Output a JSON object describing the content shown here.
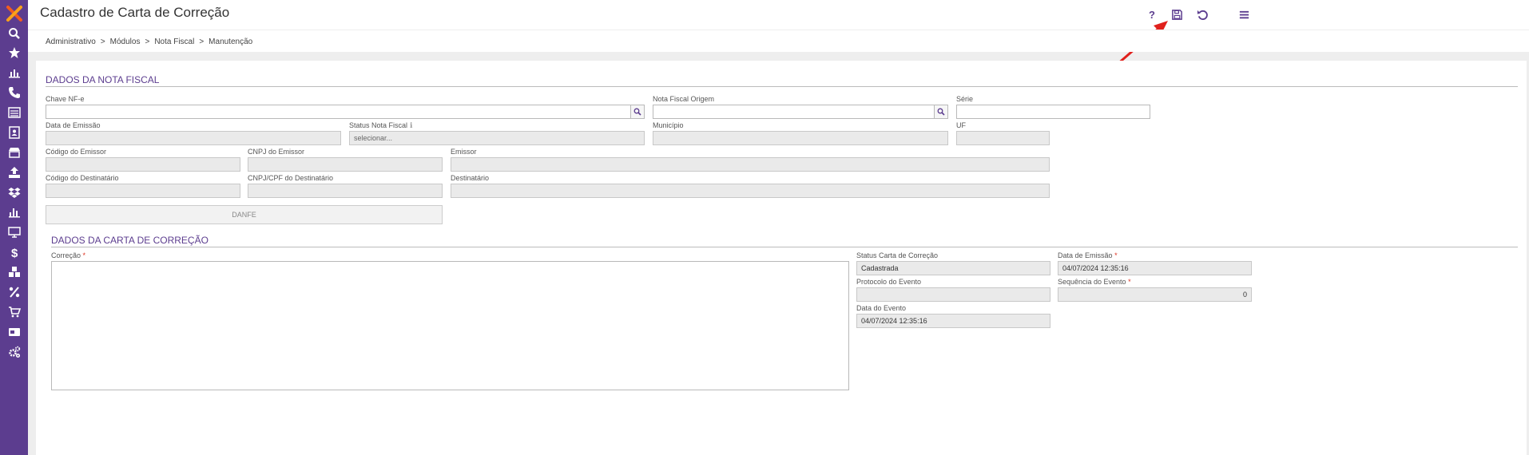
{
  "header": {
    "title": "Cadastro de Carta de Correção",
    "help_label": "?"
  },
  "breadcrumb": [
    "Administrativo",
    ">",
    "Módulos",
    ">",
    "Nota Fiscal",
    ">",
    "Manutenção"
  ],
  "nota_fiscal": {
    "section_title": "DADOS DA NOTA FISCAL",
    "chave_nfe": {
      "label": "Chave NF-e",
      "value": ""
    },
    "nf_origem": {
      "label": "Nota Fiscal Origem",
      "value": ""
    },
    "serie": {
      "label": "Série",
      "value": ""
    },
    "data_emissao": {
      "label": "Data de Emissão",
      "value": ""
    },
    "status_nf": {
      "label": "Status Nota Fiscal",
      "info": "ℹ",
      "value": "selecionar..."
    },
    "municipio": {
      "label": "Município",
      "value": ""
    },
    "uf": {
      "label": "UF",
      "value": ""
    },
    "codigo_emissor": {
      "label": "Código do Emissor",
      "value": ""
    },
    "cnpj_emissor": {
      "label": "CNPJ do Emissor",
      "value": ""
    },
    "emissor": {
      "label": "Emissor",
      "value": ""
    },
    "codigo_destinatario": {
      "label": "Código do Destinatário",
      "value": ""
    },
    "cnpj_destinatario": {
      "label": "CNPJ/CPF do Destinatário",
      "value": ""
    },
    "destinatario": {
      "label": "Destinatário",
      "value": ""
    },
    "danfe_label": "DANFE"
  },
  "carta": {
    "section_title": "DADOS DA CARTA DE CORREÇÃO",
    "correcao": {
      "label": "Correção",
      "required": "*",
      "value": ""
    },
    "status_carta": {
      "label": "Status Carta de Correção",
      "value": "Cadastrada"
    },
    "data_emissao": {
      "label": "Data de Emissão",
      "required": "*",
      "value": "04/07/2024 12:35:16"
    },
    "protocolo": {
      "label": "Protocolo do Evento",
      "value": ""
    },
    "sequencia": {
      "label": "Sequência do Evento",
      "required": "*",
      "value": "0"
    },
    "data_evento": {
      "label": "Data do Evento",
      "value": "04/07/2024 12:35:16"
    }
  },
  "icons": {
    "sidebar": [
      "logo-icon",
      "search-icon",
      "star-icon",
      "chart-icon",
      "phone-icon",
      "list-icon",
      "contact-icon",
      "store-icon",
      "upload-icon",
      "dropbox-icon",
      "bar-chart-icon",
      "monitor-icon",
      "dollar-icon",
      "cubes-icon",
      "percent-icon",
      "cart-icon",
      "card-icon",
      "cogs-icon"
    ],
    "toolbar": [
      "help-icon",
      "save-icon",
      "undo-icon",
      "menu-icon"
    ]
  },
  "colors": {
    "brand": "#5c3d8f",
    "required": "#dd3322",
    "annotation_arrow": "#e0201c"
  }
}
